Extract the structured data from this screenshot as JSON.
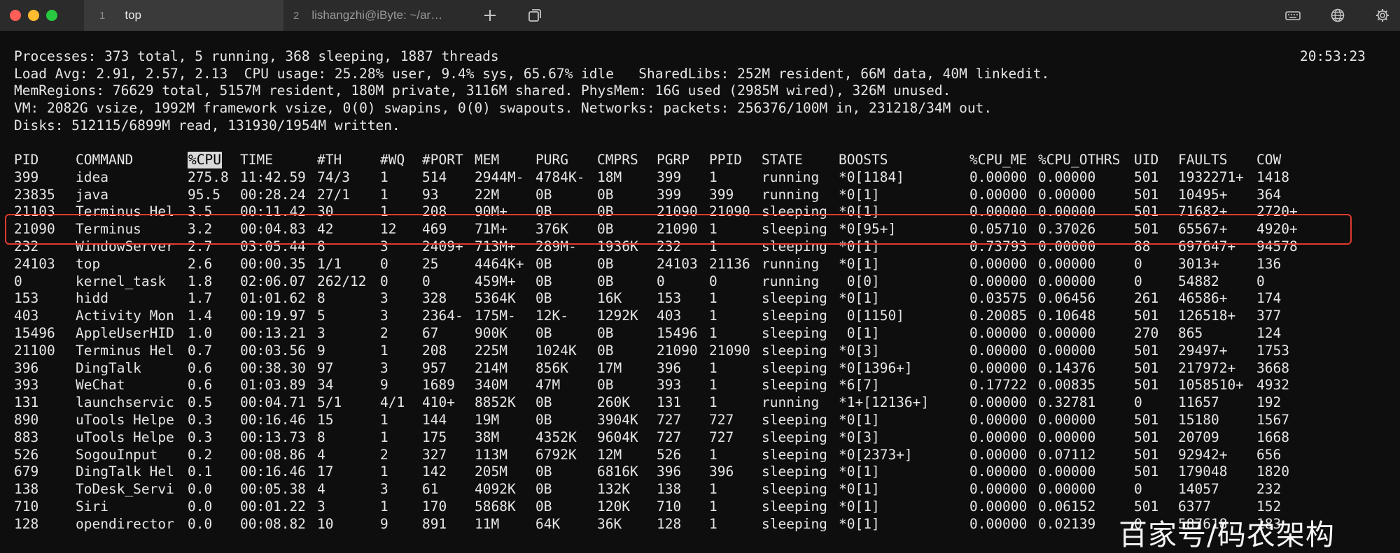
{
  "window": {
    "tabs": [
      {
        "index": "1",
        "label": "top",
        "active": true
      },
      {
        "index": "2",
        "label": "lishangzhi@iByte: ~/ar…",
        "active": false
      }
    ],
    "colors": {
      "close": "#ff5f57",
      "minimize": "#febc2e",
      "maximize": "#28c840"
    },
    "icons": [
      "plus-icon",
      "tabs-overview-icon",
      "keyboard-icon",
      "globe-icon",
      "gear-icon"
    ]
  },
  "summary": {
    "processes": "Processes: 373 total, 5 running, 368 sleeping, 1887 threads",
    "time": "20:53:23",
    "load": "Load Avg: 2.91, 2.57, 2.13  CPU usage: 25.28% user, 9.4% sys, 65.67% idle   SharedLibs: 252M resident, 66M data, 40M linkedit.",
    "memregions": "MemRegions: 76629 total, 5157M resident, 180M private, 3116M shared. PhysMem: 16G used (2985M wired), 326M unused.",
    "vm": "VM: 2082G vsize, 1992M framework vsize, 0(0) swapins, 0(0) swapouts. Networks: packets: 256376/100M in, 231218/34M out.",
    "disks": "Disks: 512115/6899M read, 131930/1954M written."
  },
  "table": {
    "sorted_column": "%CPU",
    "highlight_color": "#e03a2f",
    "columns": [
      "PID",
      "COMMAND",
      "%CPU",
      "TIME",
      "#TH",
      "#WQ",
      "#PORT",
      "MEM",
      "PURG",
      "CMPRS",
      "PGRP",
      "PPID",
      "STATE",
      "BOOSTS",
      "%CPU_ME",
      "%CPU_OTHRS",
      "UID",
      "FAULTS",
      "COW"
    ],
    "rows": [
      [
        "399",
        "idea",
        "275.8",
        "11:42.59",
        "74/3",
        "1",
        "514",
        "2944M-",
        "4784K-",
        "18M",
        "399",
        "1",
        "running",
        "*0[1184]",
        "0.00000",
        "0.00000",
        "501",
        "1932271+",
        "1418"
      ],
      [
        "23835",
        "java",
        "95.5",
        "00:28.24",
        "27/1",
        "1",
        "93",
        "22M",
        "0B",
        "0B",
        "399",
        "399",
        "running",
        "*0[1]",
        "0.00000",
        "0.00000",
        "501",
        "10495+",
        "364"
      ],
      [
        "21103",
        "Terminus Hel",
        "3.5",
        "00:11.42",
        "30",
        "1",
        "208",
        "90M+",
        "0B",
        "0B",
        "21090",
        "21090",
        "sleeping",
        "*0[1]",
        "0.00000",
        "0.00000",
        "501",
        "71682+",
        "2720+"
      ],
      [
        "21090",
        "Terminus",
        "3.2",
        "00:04.83",
        "42",
        "12",
        "469",
        "71M+",
        "376K",
        "0B",
        "21090",
        "1",
        "sleeping",
        "*0[95+]",
        "0.05710",
        "0.37026",
        "501",
        "65567+",
        "4920+"
      ],
      [
        "232",
        "WindowServer",
        "2.7",
        "03:05.44",
        "8",
        "3",
        "2409+",
        "713M+",
        "289M-",
        "1936K",
        "232",
        "1",
        "sleeping",
        "*0[1]",
        "0.73793",
        "0.00000",
        "88",
        "697647+",
        "94578"
      ],
      [
        "24103",
        "top",
        "2.6",
        "00:00.35",
        "1/1",
        "0",
        "25",
        "4464K+",
        "0B",
        "0B",
        "24103",
        "21136",
        "running",
        "*0[1]",
        "0.00000",
        "0.00000",
        "0",
        "3013+",
        "136"
      ],
      [
        "0",
        "kernel_task",
        "1.8",
        "02:06.07",
        "262/12",
        "0",
        "0",
        "459M+",
        "0B",
        "0B",
        "0",
        "0",
        "running",
        " 0[0]",
        "0.00000",
        "0.00000",
        "0",
        "54882",
        "0"
      ],
      [
        "153",
        "hidd",
        "1.7",
        "01:01.62",
        "8",
        "3",
        "328",
        "5364K",
        "0B",
        "16K",
        "153",
        "1",
        "sleeping",
        "*0[1]",
        "0.03575",
        "0.06456",
        "261",
        "46586+",
        "174"
      ],
      [
        "403",
        "Activity Mon",
        "1.4",
        "00:19.97",
        "5",
        "3",
        "2364-",
        "175M-",
        "12K-",
        "1292K",
        "403",
        "1",
        "sleeping",
        " 0[1150]",
        "0.20085",
        "0.10648",
        "501",
        "126518+",
        "377"
      ],
      [
        "15496",
        "AppleUserHID",
        "1.0",
        "00:13.21",
        "3",
        "2",
        "67",
        "900K",
        "0B",
        "0B",
        "15496",
        "1",
        "sleeping",
        " 0[1]",
        "0.00000",
        "0.00000",
        "270",
        "865",
        "124"
      ],
      [
        "21100",
        "Terminus Hel",
        "0.7",
        "00:03.56",
        "9",
        "1",
        "208",
        "225M",
        "1024K",
        "0B",
        "21090",
        "21090",
        "sleeping",
        "*0[3]",
        "0.00000",
        "0.00000",
        "501",
        "29497+",
        "1753"
      ],
      [
        "396",
        "DingTalk",
        "0.6",
        "00:38.30",
        "97",
        "3",
        "957",
        "214M",
        "856K",
        "17M",
        "396",
        "1",
        "sleeping",
        "*0[1396+]",
        "0.00000",
        "0.14376",
        "501",
        "217972+",
        "3668"
      ],
      [
        "393",
        "WeChat",
        "0.6",
        "01:03.89",
        "34",
        "9",
        "1689",
        "340M",
        "47M",
        "0B",
        "393",
        "1",
        "sleeping",
        "*6[7]",
        "0.17722",
        "0.00835",
        "501",
        "1058510+",
        "4932"
      ],
      [
        "131",
        "launchservic",
        "0.5",
        "00:04.71",
        "5/1",
        "4/1",
        "410+",
        "8852K",
        "0B",
        "260K",
        "131",
        "1",
        "running",
        "*1+[12136+]",
        "0.00000",
        "0.32781",
        "0",
        "11657",
        "192"
      ],
      [
        "890",
        "uTools Helpe",
        "0.3",
        "00:16.46",
        "15",
        "1",
        "144",
        "19M",
        "0B",
        "3904K",
        "727",
        "727",
        "sleeping",
        "*0[1]",
        "0.00000",
        "0.00000",
        "501",
        "15180",
        "1567"
      ],
      [
        "883",
        "uTools Helpe",
        "0.3",
        "00:13.73",
        "8",
        "1",
        "175",
        "38M",
        "4352K",
        "9604K",
        "727",
        "727",
        "sleeping",
        "*0[3]",
        "0.00000",
        "0.00000",
        "501",
        "20709",
        "1668"
      ],
      [
        "526",
        "SogouInput",
        "0.2",
        "00:08.86",
        "4",
        "2",
        "327",
        "113M",
        "6792K",
        "12M",
        "526",
        "1",
        "sleeping",
        "*0[2373+]",
        "0.00000",
        "0.07112",
        "501",
        "92942+",
        "656"
      ],
      [
        "679",
        "DingTalk Hel",
        "0.1",
        "00:16.46",
        "17",
        "1",
        "142",
        "205M",
        "0B",
        "6816K",
        "396",
        "396",
        "sleeping",
        "*0[1]",
        "0.00000",
        "0.00000",
        "501",
        "179048",
        "1820"
      ],
      [
        "138",
        "ToDesk_Servi",
        "0.0",
        "00:05.38",
        "4",
        "3",
        "61",
        "4092K",
        "0B",
        "132K",
        "138",
        "1",
        "sleeping",
        "*0[1]",
        "0.00000",
        "0.00000",
        "0",
        "14057",
        "232"
      ],
      [
        "710",
        "Siri",
        "0.0",
        "00:01.22",
        "3",
        "1",
        "170",
        "5868K",
        "0B",
        "120K",
        "710",
        "1",
        "sleeping",
        "*0[1]",
        "0.00000",
        "0.06152",
        "501",
        "6377",
        "152"
      ],
      [
        "128",
        "opendirector",
        "0.0",
        "00:08.82",
        "10",
        "9",
        "891",
        "11M",
        "64K",
        "36K",
        "128",
        "1",
        "sleeping",
        "*0[1]",
        "0.00000",
        "0.02139",
        "0",
        "587618",
        "183"
      ]
    ]
  },
  "watermark": "百家号/码农架构"
}
